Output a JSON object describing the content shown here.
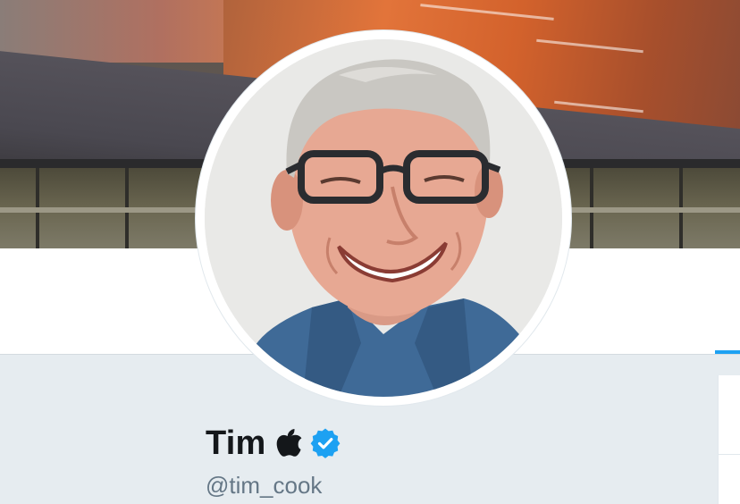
{
  "profile": {
    "name": "Tim",
    "handle": "@tim_cook",
    "name_icon": "apple-logo-icon",
    "verified_icon": "verified-badge-icon",
    "verified": true
  },
  "colors": {
    "accent": "#1da1f2",
    "name_text": "#14171a",
    "handle_text": "#657786",
    "page_background": "#e6ecf0"
  }
}
